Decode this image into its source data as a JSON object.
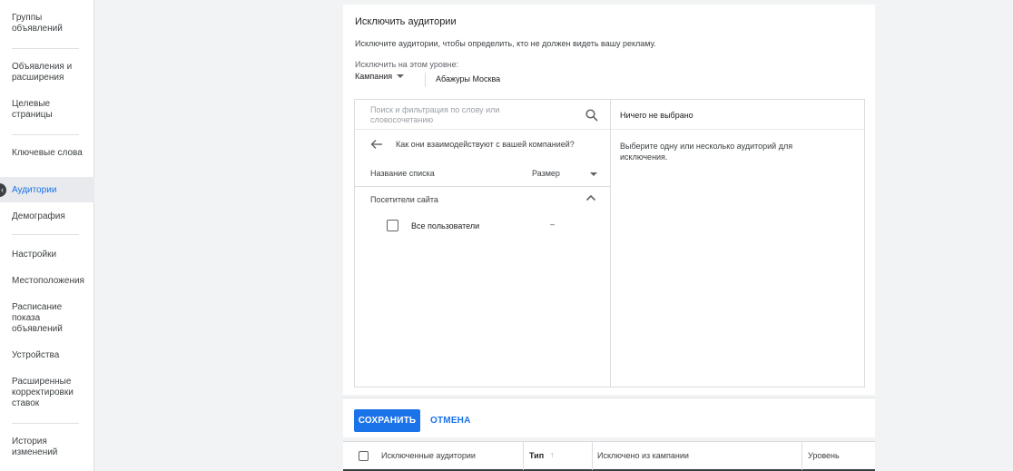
{
  "sidebar": {
    "items": [
      {
        "label": "Группы объявлений"
      },
      {
        "label": "Объявления и расширения"
      },
      {
        "label": "Целевые страницы"
      },
      {
        "label": "Ключевые слова"
      },
      {
        "label": "Аудитории",
        "active": true
      },
      {
        "label": "Демография"
      },
      {
        "label": "Настройки"
      },
      {
        "label": "Местоположения"
      },
      {
        "label": "Расписание показа объявлений"
      },
      {
        "label": "Устройства"
      },
      {
        "label": "Расширенные корректировки ставок"
      },
      {
        "label": "История изменений"
      }
    ],
    "collapse_glyph": "‹"
  },
  "exclude": {
    "title": "Исключить аудитории",
    "description": "Исключите аудитории, чтобы определить, кто не должен видеть вашу рекламу.",
    "level_label": "Исключить на этом уровне:",
    "level_value": "Кампания",
    "campaign_name": "Абажуры Москва",
    "search_placeholder": "Поиск и фильтрация по слову или словосочетанию",
    "back_label": "Как они взаимодействуют с вашей компанией?",
    "col_list_name": "Название списка",
    "col_size": "Размер",
    "group_label": "Посетители сайта",
    "item_label": "Все пользователи",
    "item_size": "–",
    "selected_header": "Ничего не выбрано",
    "selected_hint": "Выберите одну или несколько аудиторий для исключения."
  },
  "actions": {
    "save_label": "СОХРАНИТЬ",
    "cancel_label": "ОТМЕНА"
  },
  "table": {
    "columns": [
      "Исключенные аудитории",
      "Тип",
      "Исключено из кампании",
      "Уровень"
    ],
    "sort_glyph": "↑"
  },
  "colors": {
    "accent": "#1a73e8",
    "background": "#f1f3f4"
  }
}
